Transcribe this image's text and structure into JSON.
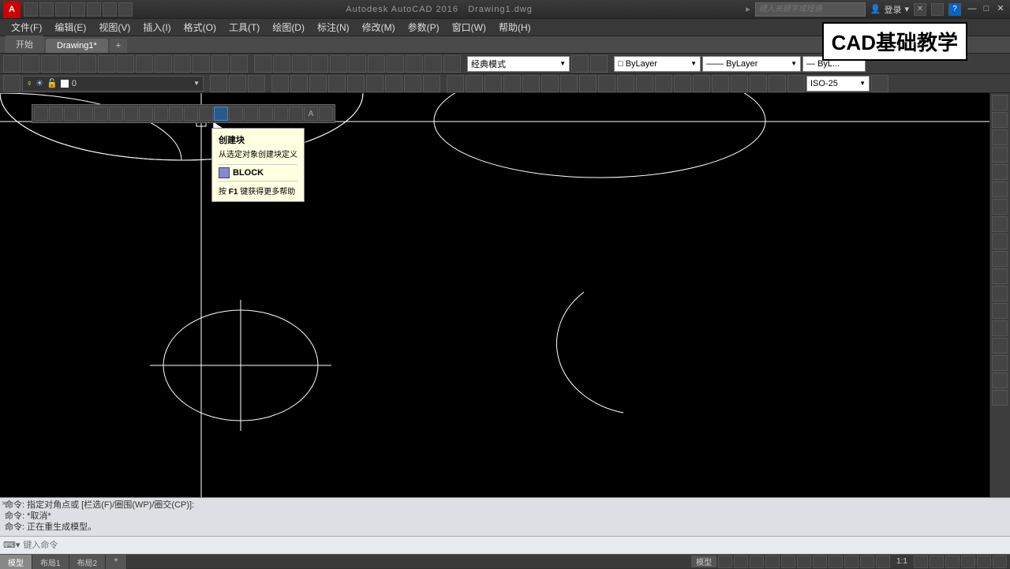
{
  "title_bar": {
    "app_name": "Autodesk AutoCAD 2016",
    "doc_name": "Drawing1.dwg",
    "search_placeholder": "键入关键字或短语",
    "login_label": "登录"
  },
  "menu": {
    "file": "文件(F)",
    "edit": "编辑(E)",
    "view": "视图(V)",
    "insert": "插入(I)",
    "format": "格式(O)",
    "tools": "工具(T)",
    "draw": "绘图(D)",
    "dimension": "标注(N)",
    "modify": "修改(M)",
    "parametric": "参数(P)",
    "window": "窗口(W)",
    "help": "帮助(H)"
  },
  "tabs": {
    "start": "开始",
    "drawing": "Drawing1*",
    "plus": "+"
  },
  "toolbar3": {
    "workspace": "经典模式",
    "color": "ByLayer",
    "linetype": "ByLayer",
    "lineweight": "ByL...",
    "dimstyle": "ISO-25"
  },
  "layer": {
    "current": "0"
  },
  "tooltip": {
    "title": "创建块",
    "desc": "从选定对象创建块定义",
    "cmd": "BLOCK",
    "help_prefix": "按 ",
    "help_key": "F1",
    "help_suffix": " 键获得更多帮助"
  },
  "watermark": "CAD基础教学",
  "cmd": {
    "line1": "命令: 指定对角点或 [栏选(F)/圈围(WP)/圈交(CP)]:",
    "line2": "命令: *取消*",
    "line3": "命令: 正在重生成模型。",
    "prompt": "⌨▾",
    "placeholder": "键入命令"
  },
  "status": {
    "model": "模型",
    "layout1": "布局1",
    "layout2": "布局2",
    "plus": "+",
    "model_btn": "模型",
    "scale": "1:1"
  },
  "chart_data": null
}
